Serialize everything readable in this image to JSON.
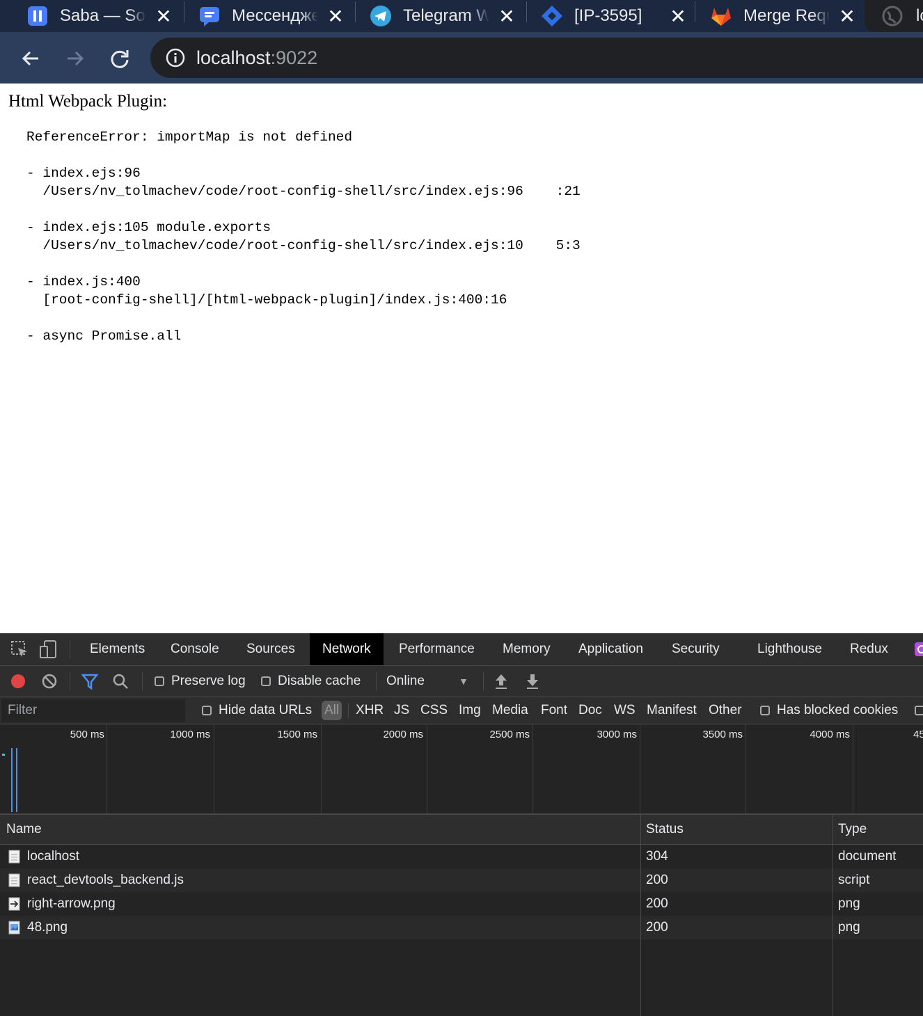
{
  "browser": {
    "tabs": [
      {
        "title": "Saba — Sonar",
        "favicon": "saba-logo-icon",
        "active": false
      },
      {
        "title": "Мессенджер",
        "favicon": "messenger-chat-icon",
        "active": false
      },
      {
        "title": "Telegram Web",
        "favicon": "telegram-icon",
        "active": false
      },
      {
        "title": "[IP-3595]",
        "favicon": "jira-icon",
        "active": false
      },
      {
        "title": "Merge Request",
        "favicon": "gitlab-icon",
        "active": false
      },
      {
        "title": "lo",
        "favicon": "globe-icon",
        "active": true
      }
    ],
    "address": {
      "host": "localhost",
      "port": ":9022"
    }
  },
  "page": {
    "title": "Html Webpack Plugin:",
    "error": "ReferenceError: importMap is not defined",
    "stack": [
      {
        "line1": "- index.ejs:96",
        "line2": "  /Users/nv_tolmachev/code/root-config-shell/src/index.ejs:96    :21"
      },
      {
        "line1": "- index.ejs:105 module.exports",
        "line2": "  /Users/nv_tolmachev/code/root-config-shell/src/index.ejs:10    5:3"
      },
      {
        "line1": "- index.js:400",
        "line2": "  [root-config-shell]/[html-webpack-plugin]/index.js:400:16"
      },
      {
        "line1": "- async Promise.all",
        "line2": ""
      }
    ]
  },
  "devtools": {
    "tabs": [
      "Elements",
      "Console",
      "Sources",
      "Network",
      "Performance",
      "Memory",
      "Application",
      "Security",
      "Lighthouse",
      "Redux"
    ],
    "active_tab": "Network",
    "toolbar": {
      "preserve_log": "Preserve log",
      "disable_cache": "Disable cache",
      "throttle": "Online"
    },
    "filter": {
      "placeholder": "Filter",
      "hide_data_urls": "Hide data URLs",
      "types": [
        "All",
        "XHR",
        "JS",
        "CSS",
        "Img",
        "Media",
        "Font",
        "Doc",
        "WS",
        "Manifest",
        "Other"
      ],
      "has_blocked_cookies": "Has blocked cookies"
    },
    "timeline_ticks": [
      "500 ms",
      "1000 ms",
      "1500 ms",
      "2000 ms",
      "2500 ms",
      "3000 ms",
      "3500 ms",
      "4000 ms",
      "45"
    ],
    "table": {
      "headers": {
        "name": "Name",
        "status": "Status",
        "type": "Type"
      },
      "rows": [
        {
          "name": "localhost",
          "status": "304",
          "type": "document",
          "icon": "document-file-icon"
        },
        {
          "name": "react_devtools_backend.js",
          "status": "200",
          "type": "script",
          "icon": "script-file-icon"
        },
        {
          "name": "right-arrow.png",
          "status": "200",
          "type": "png",
          "icon": "right-arrow-image-icon"
        },
        {
          "name": "48.png",
          "status": "200",
          "type": "png",
          "icon": "image-file-icon"
        }
      ]
    },
    "colors": {
      "record": "#e04444",
      "filter_active": "#4c8df6",
      "active_tab_bg": "#000000"
    }
  }
}
